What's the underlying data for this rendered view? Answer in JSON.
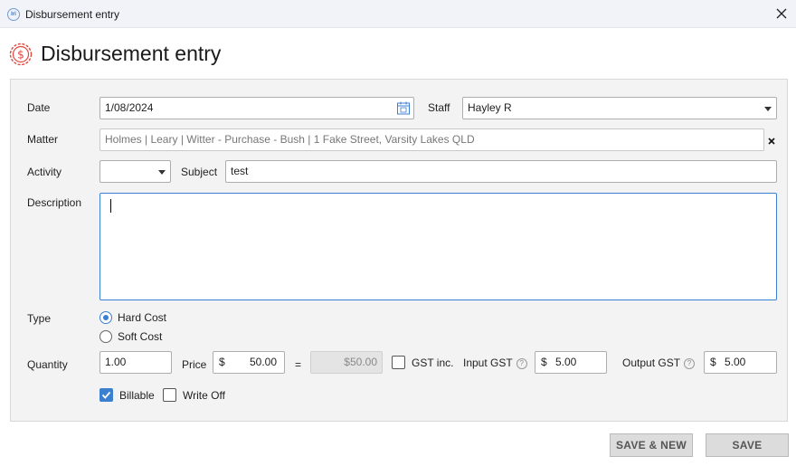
{
  "window": {
    "title": "Disbursement entry",
    "app_icon_text": "lri"
  },
  "page_title": "Disbursement entry",
  "labels": {
    "date": "Date",
    "staff": "Staff",
    "matter": "Matter",
    "activity": "Activity",
    "subject": "Subject",
    "description": "Description",
    "type": "Type",
    "quantity": "Quantity",
    "price": "Price",
    "equals": "=",
    "gst_inc": "GST inc.",
    "input_gst": "Input GST",
    "output_gst": "Output GST",
    "help_glyph": "?"
  },
  "fields": {
    "date": "1/08/2024",
    "staff": "Hayley R",
    "matter": "Holmes | Leary | Witter - Purchase - Bush | 1 Fake Street, Varsity Lakes QLD",
    "activity": "",
    "subject": "test",
    "description": "",
    "quantity": "1.00",
    "currency_symbol": "$",
    "price": "50.00",
    "total": "$50.00",
    "input_gst": "5.00",
    "output_gst": "5.00"
  },
  "type_options": [
    {
      "label": "Hard Cost",
      "selected": true
    },
    {
      "label": "Soft Cost",
      "selected": false
    }
  ],
  "checkboxes": {
    "gst_inc": {
      "label": "GST inc.",
      "checked": false
    },
    "billable": {
      "label": "Billable",
      "checked": true
    },
    "write_off": {
      "label": "Write Off",
      "checked": false
    }
  },
  "buttons": {
    "save_new": "SAVE & NEW",
    "save": "SAVE"
  },
  "colors": {
    "accent": "#3b7fd1",
    "header_icon": "#e0483f",
    "panel_bg": "#f3f3f3",
    "titlebar_bg": "#f1f3f9"
  }
}
